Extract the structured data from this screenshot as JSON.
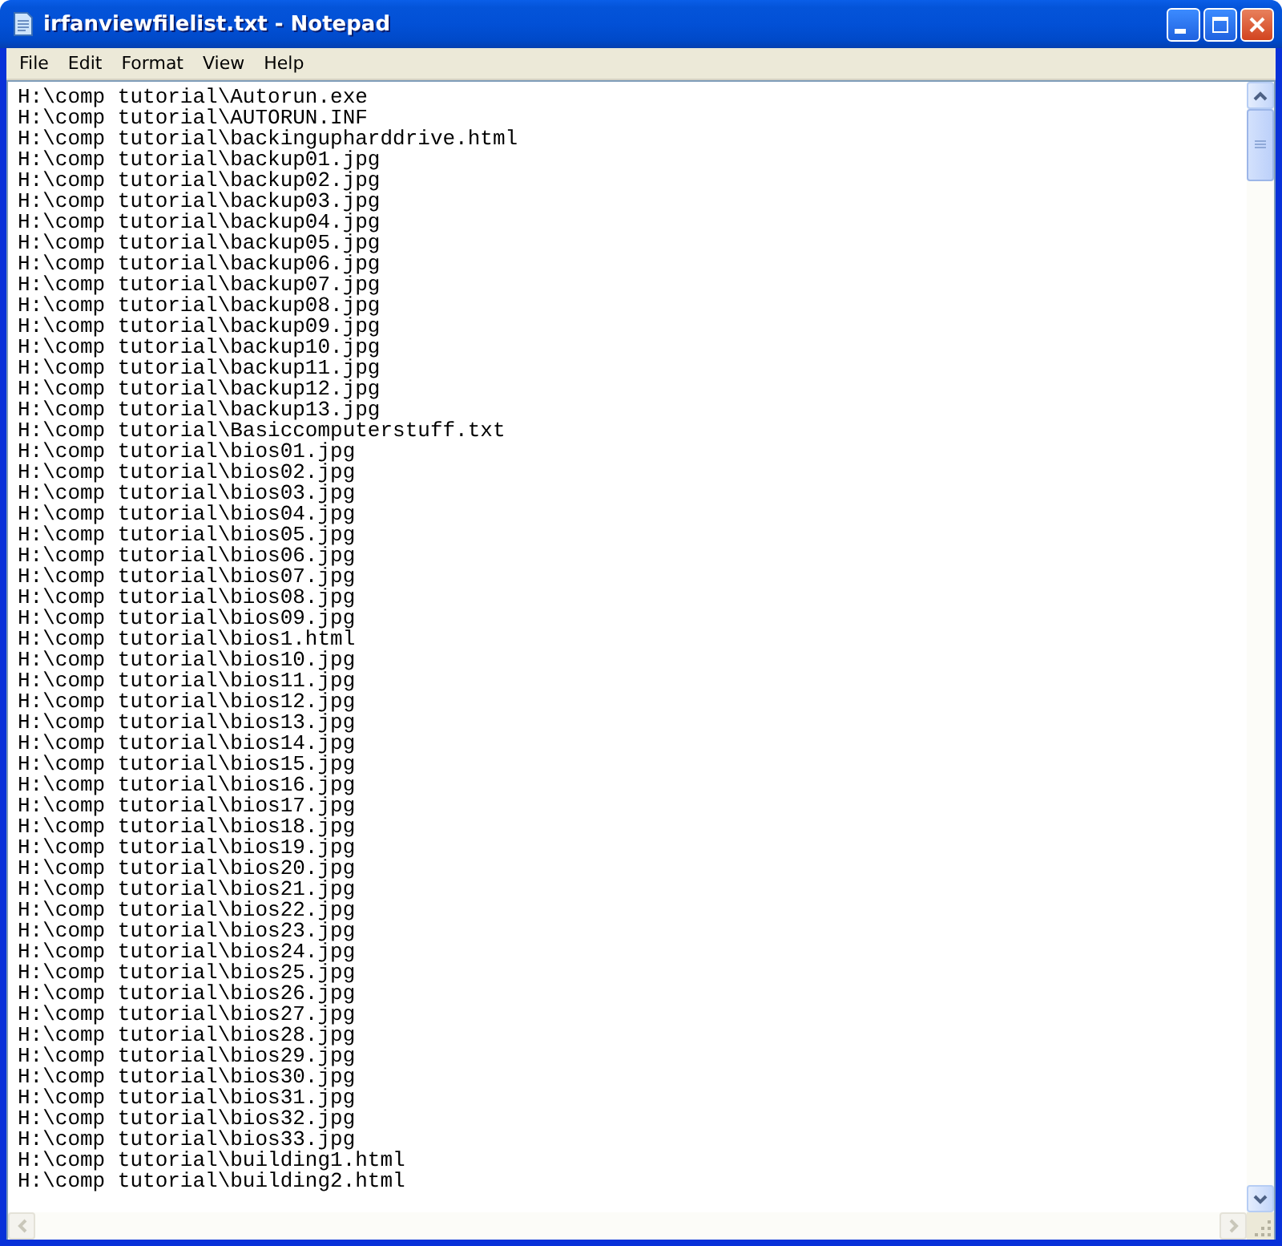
{
  "window": {
    "title": "irfanviewfilelist.txt - Notepad"
  },
  "menu": [
    "File",
    "Edit",
    "Format",
    "View",
    "Help"
  ],
  "lines": [
    "H:\\comp tutorial\\Autorun.exe",
    "H:\\comp tutorial\\AUTORUN.INF",
    "H:\\comp tutorial\\backingupharddrive.html",
    "H:\\comp tutorial\\backup01.jpg",
    "H:\\comp tutorial\\backup02.jpg",
    "H:\\comp tutorial\\backup03.jpg",
    "H:\\comp tutorial\\backup04.jpg",
    "H:\\comp tutorial\\backup05.jpg",
    "H:\\comp tutorial\\backup06.jpg",
    "H:\\comp tutorial\\backup07.jpg",
    "H:\\comp tutorial\\backup08.jpg",
    "H:\\comp tutorial\\backup09.jpg",
    "H:\\comp tutorial\\backup10.jpg",
    "H:\\comp tutorial\\backup11.jpg",
    "H:\\comp tutorial\\backup12.jpg",
    "H:\\comp tutorial\\backup13.jpg",
    "H:\\comp tutorial\\Basiccomputerstuff.txt",
    "H:\\comp tutorial\\bios01.jpg",
    "H:\\comp tutorial\\bios02.jpg",
    "H:\\comp tutorial\\bios03.jpg",
    "H:\\comp tutorial\\bios04.jpg",
    "H:\\comp tutorial\\bios05.jpg",
    "H:\\comp tutorial\\bios06.jpg",
    "H:\\comp tutorial\\bios07.jpg",
    "H:\\comp tutorial\\bios08.jpg",
    "H:\\comp tutorial\\bios09.jpg",
    "H:\\comp tutorial\\bios1.html",
    "H:\\comp tutorial\\bios10.jpg",
    "H:\\comp tutorial\\bios11.jpg",
    "H:\\comp tutorial\\bios12.jpg",
    "H:\\comp tutorial\\bios13.jpg",
    "H:\\comp tutorial\\bios14.jpg",
    "H:\\comp tutorial\\bios15.jpg",
    "H:\\comp tutorial\\bios16.jpg",
    "H:\\comp tutorial\\bios17.jpg",
    "H:\\comp tutorial\\bios18.jpg",
    "H:\\comp tutorial\\bios19.jpg",
    "H:\\comp tutorial\\bios20.jpg",
    "H:\\comp tutorial\\bios21.jpg",
    "H:\\comp tutorial\\bios22.jpg",
    "H:\\comp tutorial\\bios23.jpg",
    "H:\\comp tutorial\\bios24.jpg",
    "H:\\comp tutorial\\bios25.jpg",
    "H:\\comp tutorial\\bios26.jpg",
    "H:\\comp tutorial\\bios27.jpg",
    "H:\\comp tutorial\\bios28.jpg",
    "H:\\comp tutorial\\bios29.jpg",
    "H:\\comp tutorial\\bios30.jpg",
    "H:\\comp tutorial\\bios31.jpg",
    "H:\\comp tutorial\\bios32.jpg",
    "H:\\comp tutorial\\bios33.jpg",
    "H:\\comp tutorial\\building1.html",
    "H:\\comp tutorial\\building2.html"
  ]
}
